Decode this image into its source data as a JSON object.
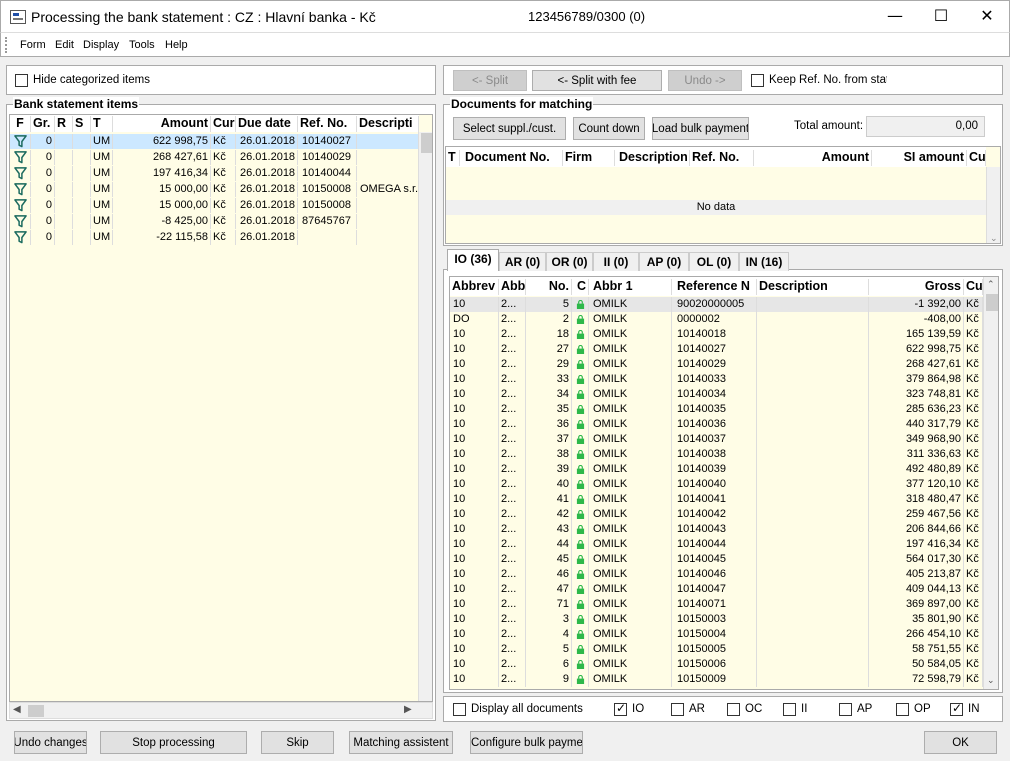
{
  "window": {
    "title": "Processing the bank statement : CZ : Hlavní banka - Kč",
    "account": "123456789/0300 (0)",
    "min": "—",
    "max": "☐",
    "close": "✕"
  },
  "menu": [
    "Form",
    "Edit",
    "Display",
    "Tools",
    "Help"
  ],
  "left": {
    "hide_categorized": "Hide categorized items",
    "group_title": "Bank statement items",
    "columns": [
      "F",
      "Gr.",
      "R",
      "S",
      "T",
      "Amount",
      "Cur",
      "Due date",
      "Ref. No.",
      "Descripti"
    ],
    "rows": [
      {
        "gr": "0",
        "t": "UM",
        "amount": "622 998,75",
        "cur": "Kč",
        "due": "26.01.2018",
        "ref": "10140027",
        "desc": ""
      },
      {
        "gr": "0",
        "t": "UM",
        "amount": "268 427,61",
        "cur": "Kč",
        "due": "26.01.2018",
        "ref": "10140029",
        "desc": ""
      },
      {
        "gr": "0",
        "t": "UM",
        "amount": "197 416,34",
        "cur": "Kč",
        "due": "26.01.2018",
        "ref": "10140044",
        "desc": ""
      },
      {
        "gr": "0",
        "t": "UM",
        "amount": "15 000,00",
        "cur": "Kč",
        "due": "26.01.2018",
        "ref": "10150008",
        "desc": "OMEGA s.r."
      },
      {
        "gr": "0",
        "t": "UM",
        "amount": "15 000,00",
        "cur": "Kč",
        "due": "26.01.2018",
        "ref": "10150008",
        "desc": ""
      },
      {
        "gr": "0",
        "t": "UM",
        "amount": "-8 425,00",
        "cur": "Kč",
        "due": "26.01.2018",
        "ref": "87645767",
        "desc": ""
      },
      {
        "gr": "0",
        "t": "UM",
        "amount": "-22 115,58",
        "cur": "Kč",
        "due": "26.01.2018",
        "ref": "",
        "desc": ""
      }
    ]
  },
  "right": {
    "split": "<- Split",
    "split_fee": "<- Split with fee",
    "undo": "Undo ->",
    "keep_ref": "Keep Ref. No. from state",
    "docs_title": "Documents for matching",
    "select": "Select suppl./cust.",
    "count_down": "Count down",
    "load_bulk": "Load bulk payment",
    "total_label": "Total amount:",
    "total_value": "0,00",
    "doc_columns": [
      "T",
      "Document No.",
      "Firm",
      "Description",
      "Ref. No.",
      "Amount",
      "SI amount",
      "Cu"
    ],
    "no_data": "No data",
    "tabs": [
      "IO (36)",
      "AR (0)",
      "OR (0)",
      "II (0)",
      "AP (0)",
      "OL (0)",
      "IN (16)"
    ],
    "list_columns": [
      "Abbrev",
      "Abb",
      "No.",
      "C",
      "Abbr 1",
      "Reference N",
      "Description",
      "Gross",
      "Cu"
    ],
    "list_rows": [
      {
        "a": "10",
        "b": "2...",
        "no": "5",
        "abbr1": "OMILK",
        "ref": "90020000005",
        "gross": "-1 392,00",
        "cu": "Kč"
      },
      {
        "a": "DO",
        "b": "2...",
        "no": "2",
        "abbr1": "OMILK",
        "ref": "0000002",
        "gross": "-408,00",
        "cu": "Kč"
      },
      {
        "a": "10",
        "b": "2...",
        "no": "18",
        "abbr1": "OMILK",
        "ref": "10140018",
        "gross": "165 139,59",
        "cu": "Kč"
      },
      {
        "a": "10",
        "b": "2...",
        "no": "27",
        "abbr1": "OMILK",
        "ref": "10140027",
        "gross": "622 998,75",
        "cu": "Kč"
      },
      {
        "a": "10",
        "b": "2...",
        "no": "29",
        "abbr1": "OMILK",
        "ref": "10140029",
        "gross": "268 427,61",
        "cu": "Kč"
      },
      {
        "a": "10",
        "b": "2...",
        "no": "33",
        "abbr1": "OMILK",
        "ref": "10140033",
        "gross": "379 864,98",
        "cu": "Kč"
      },
      {
        "a": "10",
        "b": "2...",
        "no": "34",
        "abbr1": "OMILK",
        "ref": "10140034",
        "gross": "323 748,81",
        "cu": "Kč"
      },
      {
        "a": "10",
        "b": "2...",
        "no": "35",
        "abbr1": "OMILK",
        "ref": "10140035",
        "gross": "285 636,23",
        "cu": "Kč"
      },
      {
        "a": "10",
        "b": "2...",
        "no": "36",
        "abbr1": "OMILK",
        "ref": "10140036",
        "gross": "440 317,79",
        "cu": "Kč"
      },
      {
        "a": "10",
        "b": "2...",
        "no": "37",
        "abbr1": "OMILK",
        "ref": "10140037",
        "gross": "349 968,90",
        "cu": "Kč"
      },
      {
        "a": "10",
        "b": "2...",
        "no": "38",
        "abbr1": "OMILK",
        "ref": "10140038",
        "gross": "311 336,63",
        "cu": "Kč"
      },
      {
        "a": "10",
        "b": "2...",
        "no": "39",
        "abbr1": "OMILK",
        "ref": "10140039",
        "gross": "492 480,89",
        "cu": "Kč"
      },
      {
        "a": "10",
        "b": "2...",
        "no": "40",
        "abbr1": "OMILK",
        "ref": "10140040",
        "gross": "377 120,10",
        "cu": "Kč"
      },
      {
        "a": "10",
        "b": "2...",
        "no": "41",
        "abbr1": "OMILK",
        "ref": "10140041",
        "gross": "318 480,47",
        "cu": "Kč"
      },
      {
        "a": "10",
        "b": "2...",
        "no": "42",
        "abbr1": "OMILK",
        "ref": "10140042",
        "gross": "259 467,56",
        "cu": "Kč"
      },
      {
        "a": "10",
        "b": "2...",
        "no": "43",
        "abbr1": "OMILK",
        "ref": "10140043",
        "gross": "206 844,66",
        "cu": "Kč"
      },
      {
        "a": "10",
        "b": "2...",
        "no": "44",
        "abbr1": "OMILK",
        "ref": "10140044",
        "gross": "197 416,34",
        "cu": "Kč"
      },
      {
        "a": "10",
        "b": "2...",
        "no": "45",
        "abbr1": "OMILK",
        "ref": "10140045",
        "gross": "564 017,30",
        "cu": "Kč"
      },
      {
        "a": "10",
        "b": "2...",
        "no": "46",
        "abbr1": "OMILK",
        "ref": "10140046",
        "gross": "405 213,87",
        "cu": "Kč"
      },
      {
        "a": "10",
        "b": "2...",
        "no": "47",
        "abbr1": "OMILK",
        "ref": "10140047",
        "gross": "409 044,13",
        "cu": "Kč"
      },
      {
        "a": "10",
        "b": "2...",
        "no": "71",
        "abbr1": "OMILK",
        "ref": "10140071",
        "gross": "369 897,00",
        "cu": "Kč"
      },
      {
        "a": "10",
        "b": "2...",
        "no": "3",
        "abbr1": "OMILK",
        "ref": "10150003",
        "gross": "35 801,90",
        "cu": "Kč"
      },
      {
        "a": "10",
        "b": "2...",
        "no": "4",
        "abbr1": "OMILK",
        "ref": "10150004",
        "gross": "266 454,10",
        "cu": "Kč"
      },
      {
        "a": "10",
        "b": "2...",
        "no": "5",
        "abbr1": "OMILK",
        "ref": "10150005",
        "gross": "58 751,55",
        "cu": "Kč"
      },
      {
        "a": "10",
        "b": "2...",
        "no": "6",
        "abbr1": "OMILK",
        "ref": "10150006",
        "gross": "50 584,05",
        "cu": "Kč"
      },
      {
        "a": "10",
        "b": "2...",
        "no": "9",
        "abbr1": "OMILK",
        "ref": "10150009",
        "gross": "72 598,79",
        "cu": "Kč"
      }
    ],
    "display_all": "Display all documents",
    "filters": [
      {
        "label": "IO",
        "checked": true
      },
      {
        "label": "AR",
        "checked": false
      },
      {
        "label": "OC",
        "checked": false
      },
      {
        "label": "II",
        "checked": false
      },
      {
        "label": "AP",
        "checked": false
      },
      {
        "label": "OP",
        "checked": false
      },
      {
        "label": "IN",
        "checked": true
      }
    ]
  },
  "bottom": {
    "undo": "Undo changes",
    "stop": "Stop processing",
    "skip": "Skip",
    "assist": "Matching assistent",
    "bulk": "Configure bulk payment",
    "ok": "OK"
  },
  "colors": {
    "selected_row": "#cce8ff",
    "grid_bg": "#fffde6",
    "lock": "#2db84a",
    "filter_icon": "#1a6a5e"
  },
  "icons": {
    "scroll_up": "▲",
    "scroll_down": "▼",
    "scroll_left": "◀",
    "scroll_right": "▶"
  }
}
